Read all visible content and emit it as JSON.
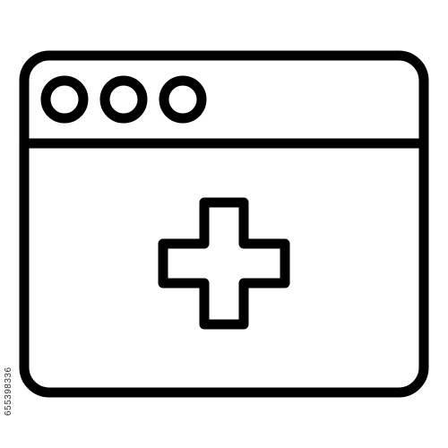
{
  "icon": {
    "name": "browser-window-plus-icon",
    "stroke_color": "#000000",
    "fill_color": "#ffffff",
    "dot_count": 3
  },
  "watermark": {
    "image_id": "655398336"
  }
}
